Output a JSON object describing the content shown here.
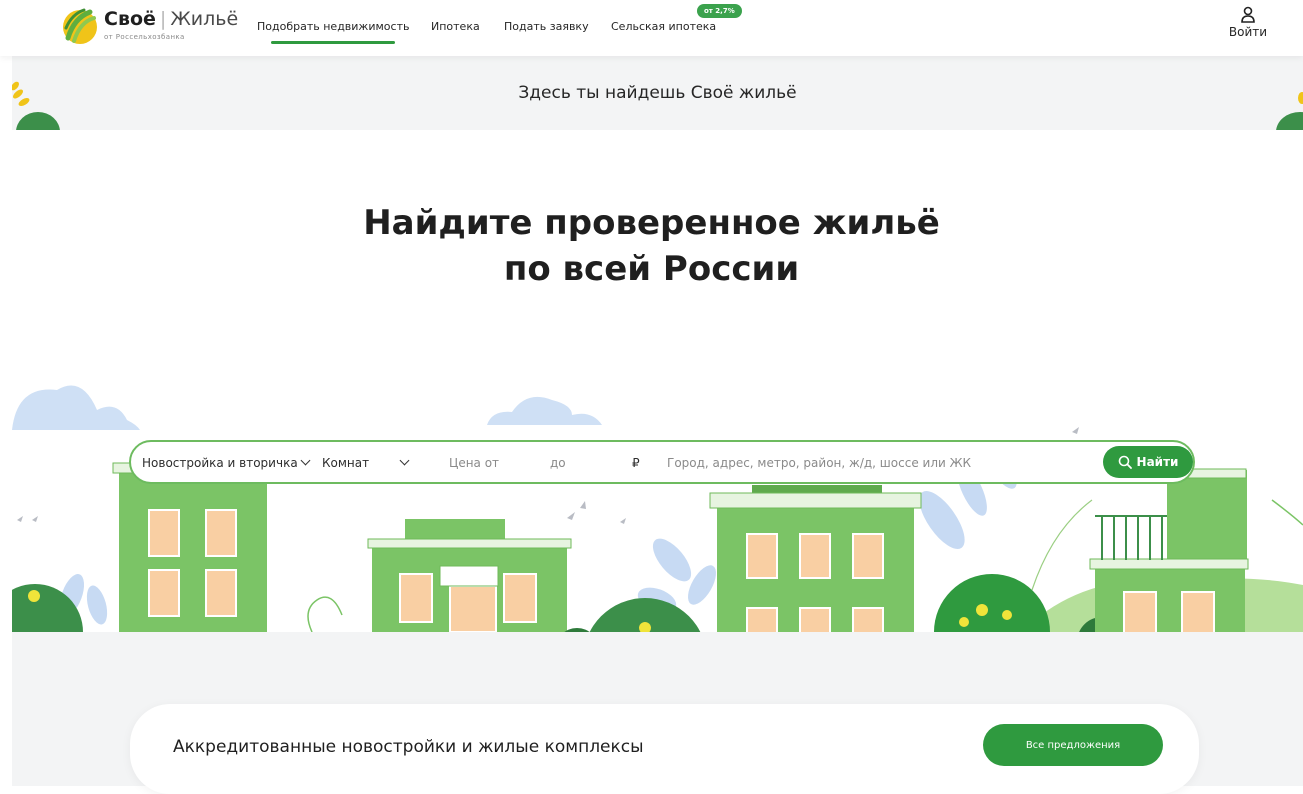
{
  "colors": {
    "accent": "#2f9a3f",
    "band_bg": "#f3f4f5",
    "building": "#7bc466"
  },
  "logo": {
    "word1": "Своё",
    "word2": "Жильё",
    "subtitle": "от Россельхозбанка"
  },
  "nav": {
    "items": [
      {
        "label": "Подобрать недвижимость",
        "active": true
      },
      {
        "label": "Ипотека"
      },
      {
        "label": "Подать заявку"
      },
      {
        "label": "Сельская ипотека"
      }
    ],
    "badge": "от 2,7%"
  },
  "login": {
    "label": "Войти",
    "icon": "user-icon"
  },
  "band": {
    "text": "Здесь ты найдешь Своё жильё"
  },
  "hero": {
    "line1": "Найдите проверенное жильё",
    "line2": "по всей России"
  },
  "search": {
    "type_value": "Новостройка и вторичка",
    "rooms_value": "Комнат",
    "price_from": "Цена от",
    "price_to": "до",
    "currency": "₽",
    "location_placeholder": "Город, адрес, метро, район, ж/д, шоссе или ЖК",
    "find_label": "Найти",
    "find_icon": "search-icon"
  },
  "section": {
    "title": "Аккредитованные новостройки и жилые комплексы",
    "button_label": "Все предложения"
  }
}
